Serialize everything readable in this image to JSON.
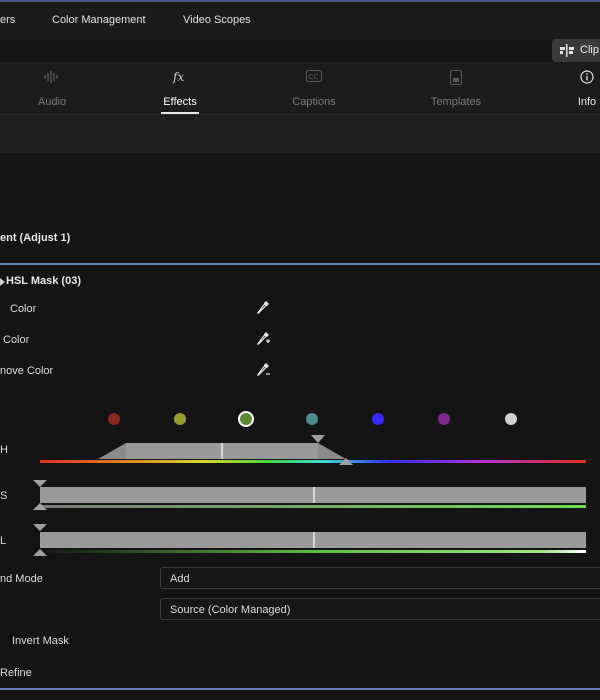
{
  "menu": {
    "items": [
      {
        "label": "ers"
      },
      {
        "label": "Color Management"
      },
      {
        "label": "Video Scopes"
      }
    ],
    "clip_button": "Clip"
  },
  "tabs": [
    {
      "label": "Audio",
      "icon": "audio-waveform-icon",
      "active": false
    },
    {
      "label": "Effects",
      "icon": "fx-icon",
      "active": true
    },
    {
      "label": "Captions",
      "icon": "captions-cc-icon",
      "active": false
    },
    {
      "label": "Templates",
      "icon": "templates-icon",
      "active": false
    },
    {
      "label": "Info",
      "icon": "info-icon",
      "active": false
    }
  ],
  "component": {
    "title": "ent (Adjust 1)"
  },
  "mask": {
    "title": "HSL Mask (03)",
    "color_rows": [
      {
        "label": "Color",
        "icon": "eyedropper-icon"
      },
      {
        "label": "Color",
        "icon": "eyedropper-add-icon"
      },
      {
        "label": "nove Color",
        "icon": "eyedropper-remove-icon"
      }
    ],
    "presets": [
      {
        "name": "red",
        "color": "#8a2a1e"
      },
      {
        "name": "yellow",
        "color": "#9a9a34"
      },
      {
        "name": "green",
        "color": "#5b8a32",
        "selected": true
      },
      {
        "name": "cyan",
        "color": "#4f8a8e"
      },
      {
        "name": "blue",
        "color": "#3a28ff"
      },
      {
        "name": "magenta",
        "color": "#7d2a8c"
      },
      {
        "name": "white",
        "color": "#d0d0d0"
      }
    ],
    "tracks": {
      "h": {
        "label": "H"
      },
      "s": {
        "label": "S"
      },
      "l": {
        "label": "L"
      }
    },
    "blend_mode": {
      "label": "nd Mode",
      "value": "Add"
    },
    "source": {
      "value": "Source (Color Managed)"
    },
    "invert_mask": {
      "label": "Invert Mask"
    },
    "refine": {
      "label": "Refine"
    }
  },
  "colors": {
    "accent": "#5f7fbf",
    "background": "#141414",
    "panel": "#1c1c1c"
  }
}
